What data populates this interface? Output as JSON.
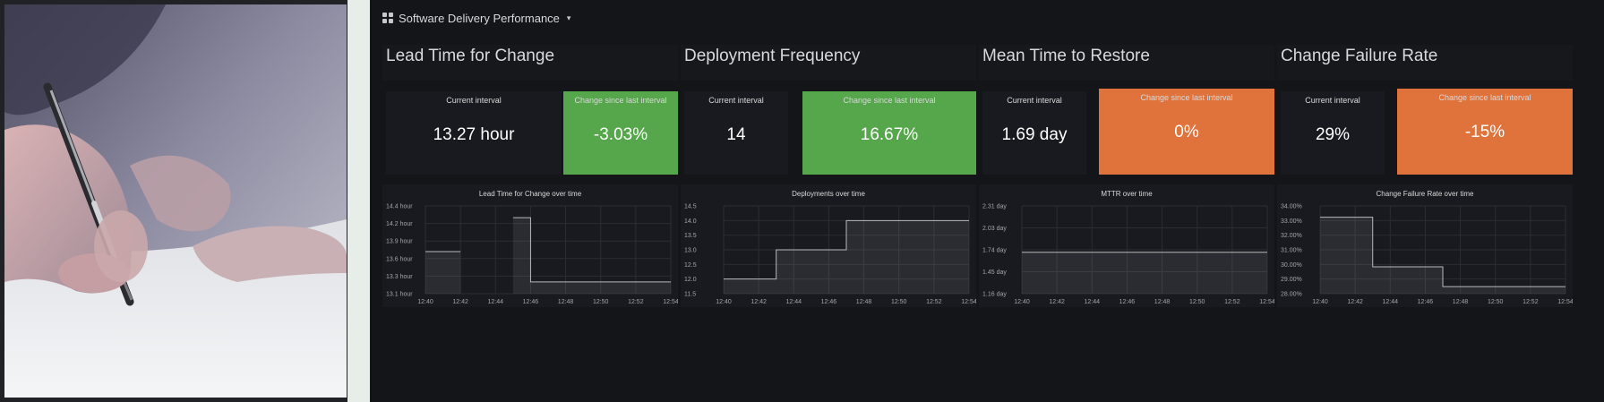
{
  "dashboard": {
    "title": "Software Delivery Performance",
    "caret": "▾"
  },
  "colors": {
    "background": "#141519",
    "panel": "#181a1f",
    "positive": "#56a64b",
    "warning": "#e0733b",
    "line": "#b8b9bc"
  },
  "metrics": [
    {
      "title": "Lead Time for Change",
      "current_label": "Current interval",
      "current_value": "13.27 hour",
      "change_label": "Change since last interval",
      "change_value": "-3.03%",
      "change_status": "positive",
      "chart": {
        "title": "Lead Time for Change over time",
        "x_ticks": [
          "12:40",
          "12:42",
          "12:44",
          "12:46",
          "12:48",
          "12:50",
          "12:52",
          "12:54"
        ],
        "y_ticks": [
          "14.4 hour",
          "14.2 hour",
          "13.9 hour",
          "13.6 hour",
          "13.3 hour",
          "13.1 hour"
        ]
      }
    },
    {
      "title": "Deployment Frequency",
      "current_label": "Current interval",
      "current_value": "14",
      "change_label": "Change since last interval",
      "change_value": "16.67%",
      "change_status": "positive",
      "chart": {
        "title": "Deployments over time",
        "x_ticks": [
          "12:40",
          "12:42",
          "12:44",
          "12:46",
          "12:48",
          "12:50",
          "12:52",
          "12:54"
        ],
        "y_ticks": [
          "14.5",
          "14.0",
          "13.5",
          "13.0",
          "12.5",
          "12.0",
          "11.5"
        ]
      }
    },
    {
      "title": "Mean Time to Restore",
      "current_label": "Current interval",
      "current_value": "1.69 day",
      "change_label": "Change since last interval",
      "change_value": "0%",
      "change_status": "warning",
      "chart": {
        "title": "MTTR over time",
        "x_ticks": [
          "12:40",
          "12:42",
          "12:44",
          "12:46",
          "12:48",
          "12:50",
          "12:52",
          "12:54"
        ],
        "y_ticks": [
          "2.31 day",
          "2.03 day",
          "1.74 day",
          "1.45 day",
          "1.16 day"
        ]
      }
    },
    {
      "title": "Change Failure Rate",
      "current_label": "Current interval",
      "current_value": "29%",
      "change_label": "Change since last interval",
      "change_value": "-15%",
      "change_status": "warning",
      "chart": {
        "title": "Change Failure Rate over time",
        "x_ticks": [
          "12:40",
          "12:42",
          "12:44",
          "12:46",
          "12:48",
          "12:50",
          "12:52",
          "12:54"
        ],
        "y_ticks": [
          "34.00%",
          "33.00%",
          "32.00%",
          "31.00%",
          "30.00%",
          "29.00%",
          "28.00%"
        ]
      }
    }
  ],
  "chart_data": [
    {
      "type": "area",
      "title": "Lead Time for Change over time",
      "xlabel": "",
      "ylabel": "",
      "ylim": [
        13.0,
        14.5
      ],
      "x": [
        "12:40",
        "12:41",
        "12:42",
        "12:43",
        "12:44",
        "12:45",
        "12:46",
        "12:48",
        "12:50",
        "12:52",
        "12:54"
      ],
      "series": [
        {
          "values": [
            13.72,
            13.72,
            13.72,
            null,
            null,
            14.3,
            13.2,
            13.2,
            13.2,
            13.2,
            13.2
          ]
        }
      ]
    },
    {
      "type": "area",
      "title": "Deployments over time",
      "xlabel": "",
      "ylabel": "",
      "ylim": [
        11.5,
        14.5
      ],
      "x": [
        "12:40",
        "12:42",
        "12:43",
        "12:46",
        "12:47",
        "12:48",
        "12:50",
        "12:52",
        "12:54"
      ],
      "series": [
        {
          "values": [
            12.0,
            12.0,
            13.0,
            13.0,
            14.0,
            14.0,
            14.0,
            14.0,
            14.0
          ]
        }
      ]
    },
    {
      "type": "area",
      "title": "MTTR over time",
      "xlabel": "",
      "ylabel": "",
      "ylim": [
        1.1,
        2.35
      ],
      "x": [
        "12:40",
        "12:42",
        "12:44",
        "12:46",
        "12:48",
        "12:50",
        "12:52",
        "12:54"
      ],
      "series": [
        {
          "values": [
            1.69,
            1.69,
            1.69,
            1.69,
            1.69,
            1.69,
            1.69,
            1.69
          ]
        }
      ]
    },
    {
      "type": "area",
      "title": "Change Failure Rate over time",
      "xlabel": "",
      "ylabel": "",
      "ylim": [
        28.0,
        34.2
      ],
      "x": [
        "12:40",
        "12:42",
        "12:43",
        "12:46",
        "12:47",
        "12:48",
        "12:50",
        "12:52",
        "12:54"
      ],
      "series": [
        {
          "values": [
            33.4,
            33.4,
            29.9,
            29.9,
            28.5,
            28.5,
            28.5,
            28.5,
            28.5
          ]
        }
      ]
    }
  ]
}
